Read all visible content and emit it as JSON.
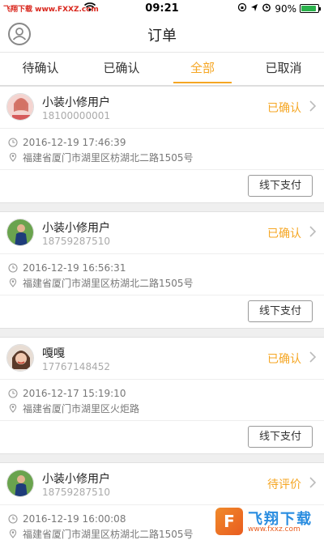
{
  "statusbar": {
    "carrier": "飞翔下载 www.FXXZ.com",
    "time": "09:21",
    "battery_percent": "90%",
    "battery_level": 0.9
  },
  "navbar": {
    "title": "订单",
    "avatar_icon": "user-circle-icon"
  },
  "tabs": [
    {
      "label": "待确认",
      "active": false
    },
    {
      "label": "已确认",
      "active": false
    },
    {
      "label": "全部",
      "active": true
    },
    {
      "label": "已取消",
      "active": false
    }
  ],
  "orders": [
    {
      "name": "小装小修用户",
      "phone": "18100000001",
      "status": "已确认",
      "time": "2016-12-19 17:46:39",
      "address": "福建省厦门市湖里区枋湖北二路1505号",
      "action": "线下支付"
    },
    {
      "name": "小装小修用户",
      "phone": "18759287510",
      "status": "已确认",
      "time": "2016-12-19 16:56:31",
      "address": "福建省厦门市湖里区枋湖北二路1505号",
      "action": "线下支付"
    },
    {
      "name": "嘎嘎",
      "phone": "17767148452",
      "status": "已确认",
      "time": "2016-12-17 15:19:10",
      "address": "福建省厦门市湖里区火炬路",
      "action": "线下支付"
    },
    {
      "name": "小装小修用户",
      "phone": "18759287510",
      "status": "待评价",
      "time": "2016-12-19 16:00:08",
      "address": "福建省厦门市湖里区枋湖北二路1505号",
      "action": ""
    }
  ],
  "watermark": {
    "text": "飞翔下载",
    "url": "www.fxxz.com"
  },
  "colors": {
    "accent": "#f5a623",
    "background": "#efefef"
  }
}
